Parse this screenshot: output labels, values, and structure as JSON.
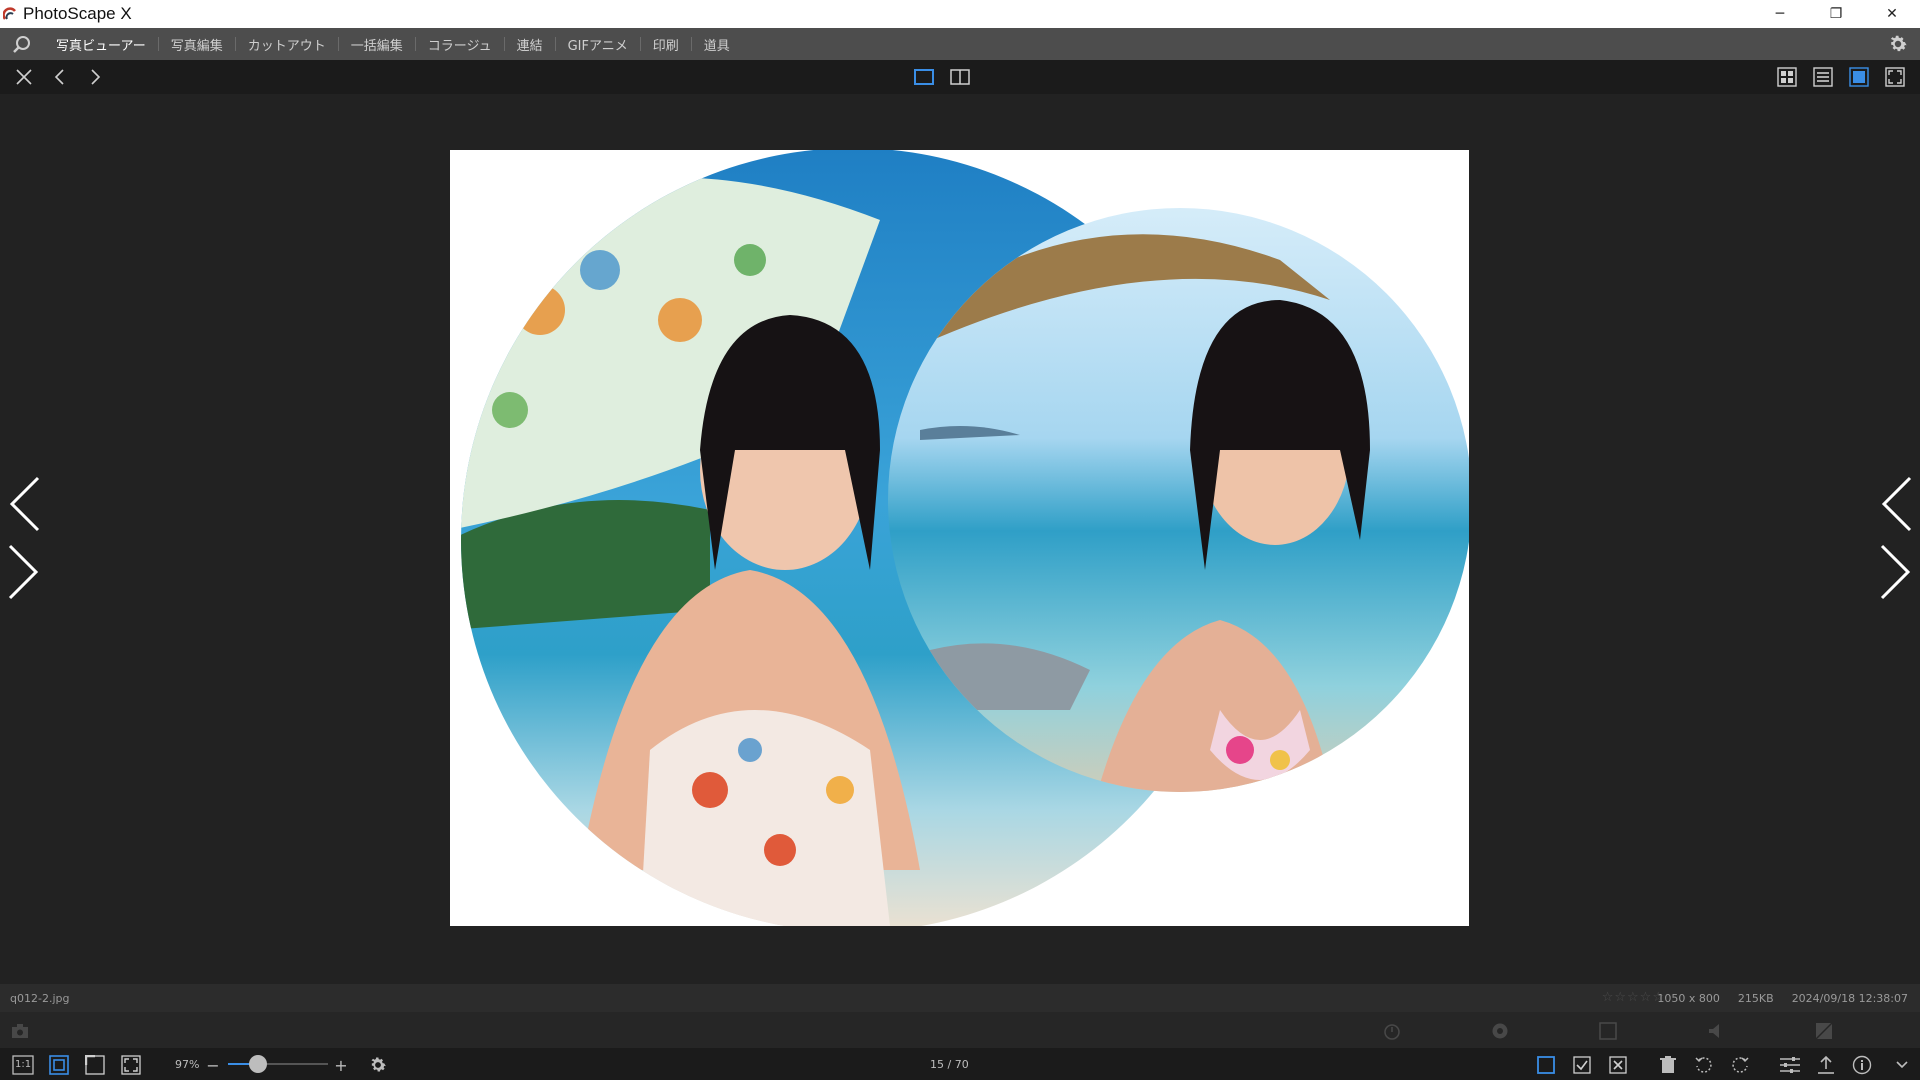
{
  "window": {
    "title": "PhotoScape X",
    "controls": {
      "minimize": "─",
      "restore": "❐",
      "close": "✕"
    }
  },
  "menu": {
    "items": [
      {
        "label": "写真ビューアー",
        "active": true
      },
      {
        "label": "写真編集"
      },
      {
        "label": "カットアウト"
      },
      {
        "label": "一括編集"
      },
      {
        "label": "コラージュ"
      },
      {
        "label": "連結"
      },
      {
        "label": "GIFアニメ"
      },
      {
        "label": "印刷"
      },
      {
        "label": "道具"
      }
    ]
  },
  "toolbar": {
    "left_icons": [
      "close-icon",
      "chevron-left-icon",
      "chevron-right-icon"
    ],
    "center_icons": [
      "single-view-icon",
      "dual-view-icon"
    ],
    "right_icons": [
      "grid-view-icon",
      "list-view-icon",
      "viewer-mode-icon",
      "fullscreen-icon"
    ]
  },
  "image": {
    "description_icons": [
      "beach-photo-left-circle",
      "beach-photo-right-circle"
    ]
  },
  "info": {
    "filename": "q012-2.jpg",
    "stars": "☆☆☆☆☆",
    "dimensions": "1050 x 800",
    "filesize": "215KB",
    "datetime": "2024/09/18 12:38:07"
  },
  "bottom": {
    "zoom": "97%",
    "zoom_minus": "−",
    "zoom_plus": "+",
    "zoom_level": 0.3,
    "page": "15 / 70",
    "one_to_one": "1:1"
  },
  "colors": {
    "accent": "#3a8ee6",
    "background": "#222222",
    "menubar": "#4d4d4d"
  }
}
